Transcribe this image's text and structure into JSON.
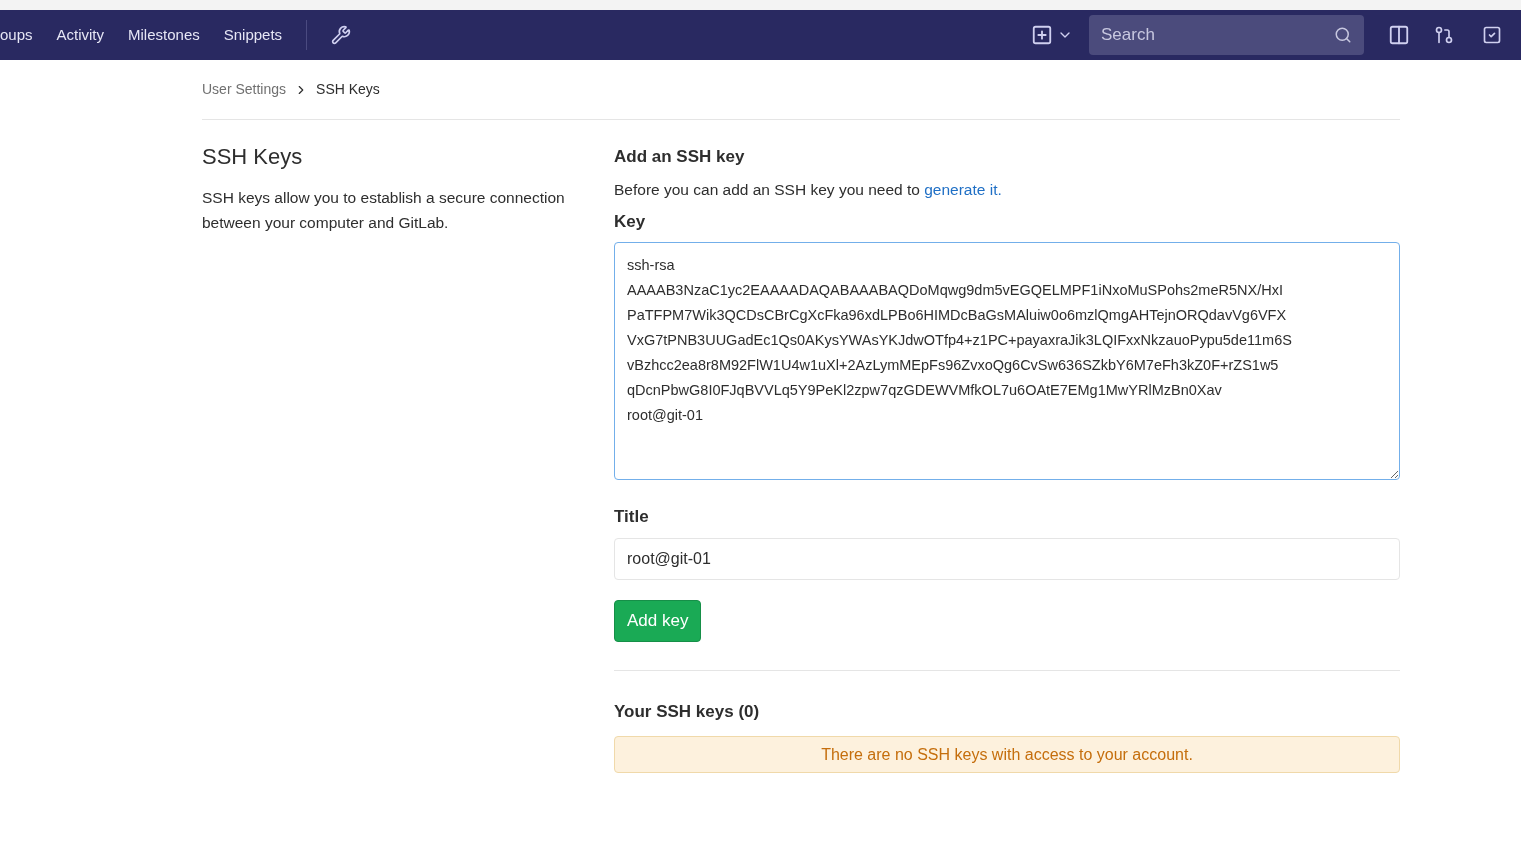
{
  "nav": {
    "items": [
      {
        "label": "oups"
      },
      {
        "label": "Activity"
      },
      {
        "label": "Milestones"
      },
      {
        "label": "Snippets"
      }
    ],
    "search": {
      "placeholder": "Search"
    }
  },
  "breadcrumb": [
    {
      "label": "User Settings",
      "current": false
    },
    {
      "label": "SSH Keys",
      "current": true
    }
  ],
  "intro": {
    "title": "SSH Keys",
    "description": "SSH keys allow you to establish a secure connection between your computer and GitLab."
  },
  "form": {
    "heading": "Add an SSH key",
    "hint": "Before you can add an SSH key you need to",
    "hint_link": "generate it.",
    "key_label": "Key",
    "key_lines": [
      "ssh-rsa",
      "AAAAB3NzaC1yc2EAAAADAQABAAABAQDoMqwg9dm5vEGQELMPF1iNxoMuSPohs2meR5NX/HxI",
      "PaTFPM7Wik3QCDsCBrCgXcFka96xdLPBo6HIMDcBaGsMAluiw0o6mzlQmgAHTejnORQdavVg6VFX",
      "VxG7tPNB3UUGadEc1Qs0AKysYWAsYKJdwOTfp4+z1PC+payaxraJik3LQIFxxNkzauoPypu5de11m6S",
      "vBzhcc2ea8r8M92FlW1U4w1uXl+2AzLymMEpFs96ZvxoQg6CvSw636SZkbY6M7eFh3kZ0F+rZS1w5",
      "qDcnPbwG8I0FJqBVVLq5Y9PeKl2zpw7qzGDEWVMfkOL7u6OAtE7EMg1MwYRlMzBn0Xav",
      "root@git-01"
    ],
    "title_label": "Title",
    "title_value": "root@git-01",
    "submit": "Add key"
  },
  "keys": {
    "heading": "Your SSH keys (0)",
    "empty_message": "There are no SSH keys with access to your account."
  }
}
